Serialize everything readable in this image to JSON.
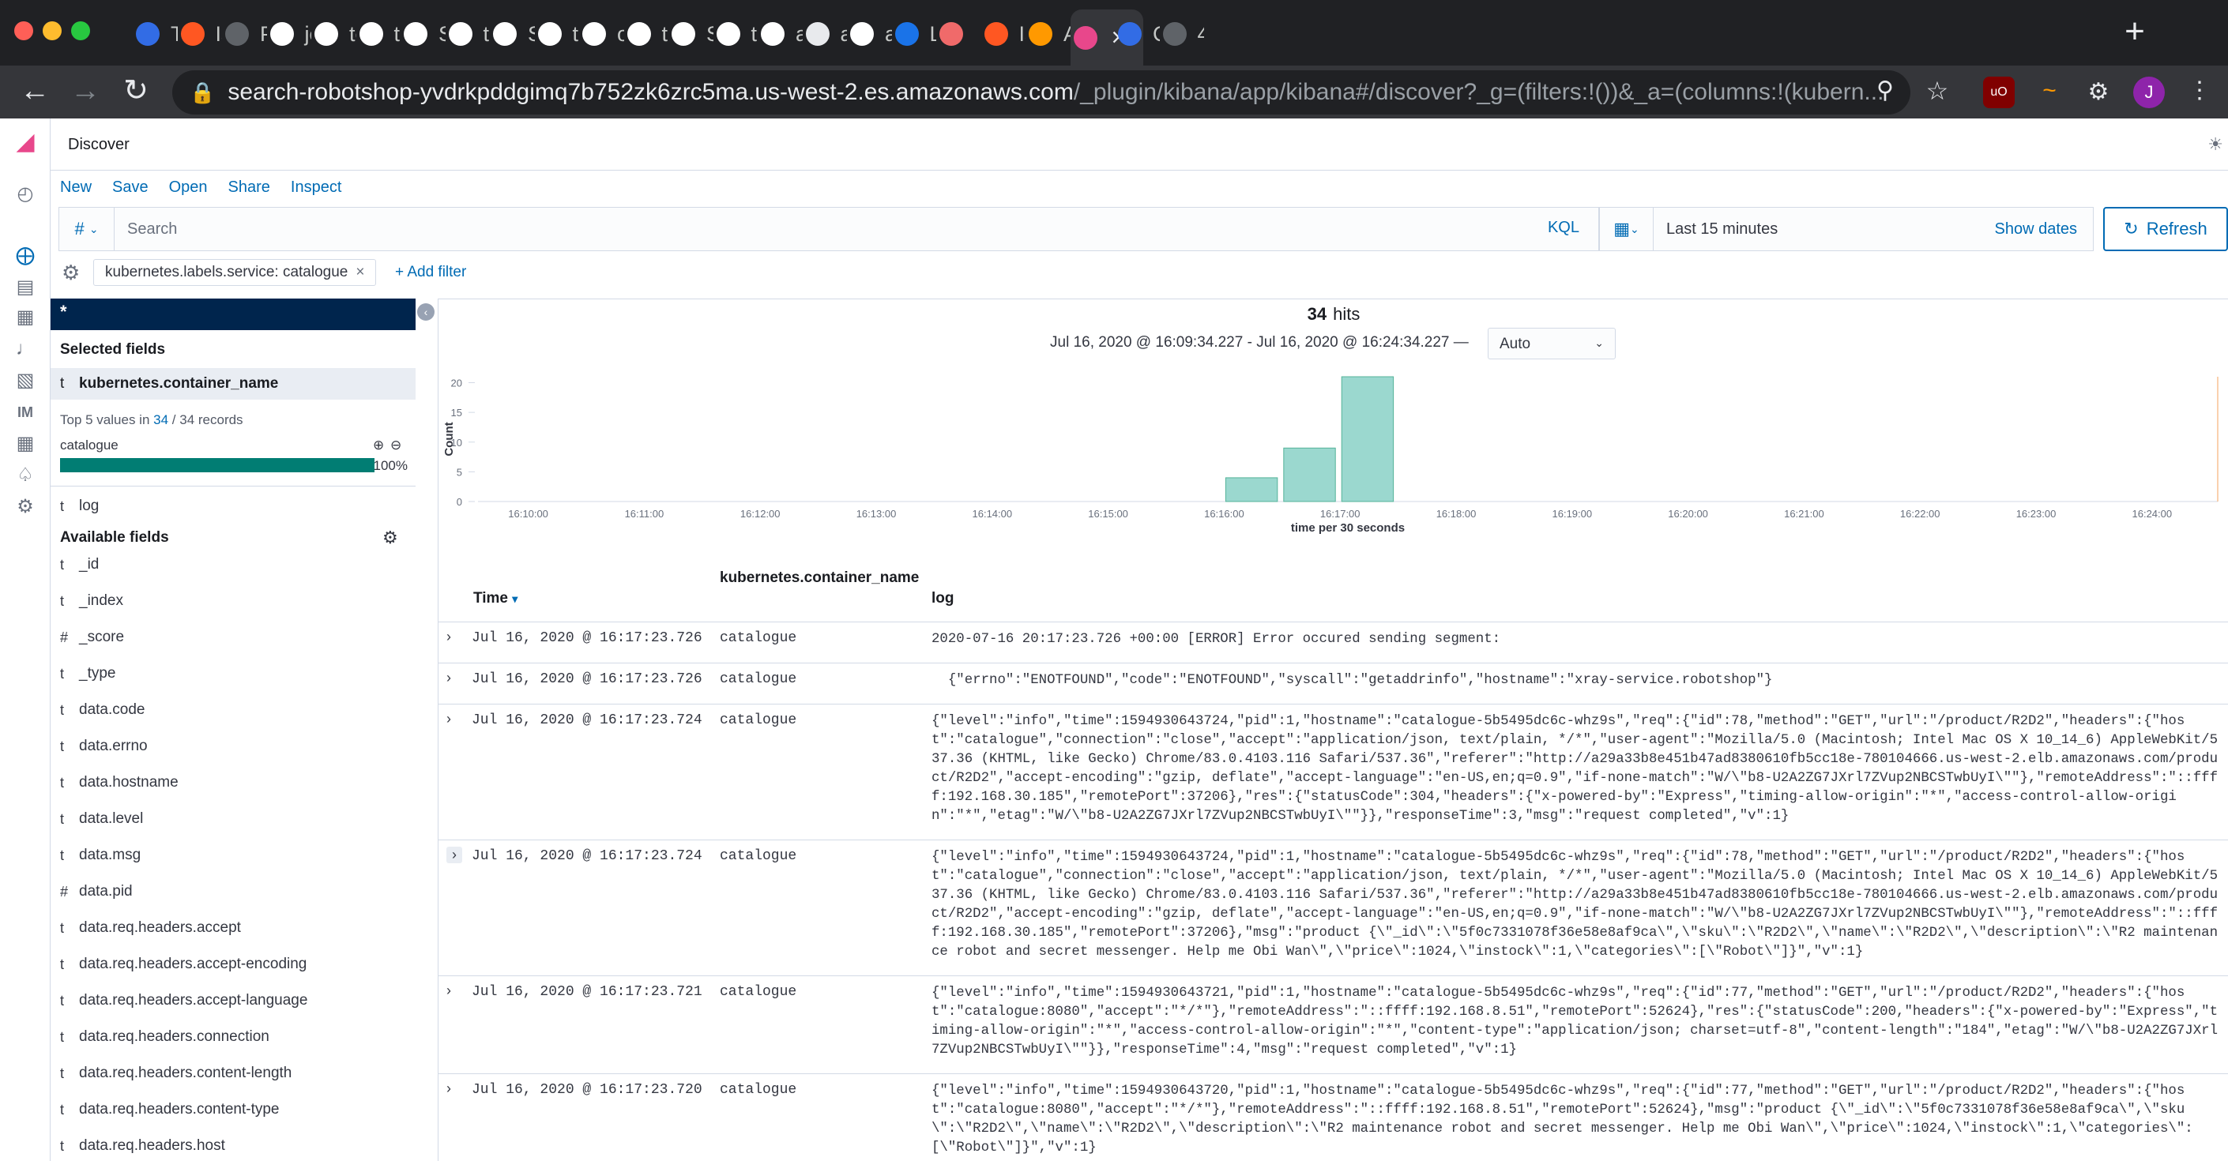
{
  "browser": {
    "tabs": [
      {
        "label": "Tr",
        "icon": "kubernetes-icon",
        "color": "#326ce5"
      },
      {
        "label": "Ist",
        "icon": "istio-icon",
        "color": "#ff5722"
      },
      {
        "label": "Pr",
        "icon": "globe-icon",
        "color": "#5f6368"
      },
      {
        "label": "jo",
        "icon": "github-icon",
        "color": "#ffffff"
      },
      {
        "label": "te",
        "icon": "github-icon",
        "color": "#ffffff"
      },
      {
        "label": "te",
        "icon": "github-icon",
        "color": "#ffffff"
      },
      {
        "label": "Se",
        "icon": "github-icon",
        "color": "#ffffff"
      },
      {
        "label": "te",
        "icon": "github-icon",
        "color": "#ffffff"
      },
      {
        "label": "Se",
        "icon": "github-icon",
        "color": "#ffffff"
      },
      {
        "label": "te",
        "icon": "github-icon",
        "color": "#ffffff"
      },
      {
        "label": "ou",
        "icon": "github-icon",
        "color": "#ffffff"
      },
      {
        "label": "te",
        "icon": "github-icon",
        "color": "#ffffff"
      },
      {
        "label": "Se",
        "icon": "github-icon",
        "color": "#ffffff"
      },
      {
        "label": "te",
        "icon": "github-icon",
        "color": "#ffffff"
      },
      {
        "label": "an",
        "icon": "github-icon",
        "color": "#ffffff"
      },
      {
        "label": "av",
        "icon": "globe-icon",
        "color": "#e8eaed"
      },
      {
        "label": "av",
        "icon": "github-icon",
        "color": "#ffffff"
      },
      {
        "label": "La",
        "icon": "aws-icon",
        "color": "#1a73e8"
      },
      {
        "label": "",
        "icon": "asana-icon",
        "color": "#f06a6a"
      },
      {
        "label": "Ist",
        "icon": "istio-icon",
        "color": "#ff5722"
      },
      {
        "label": "Ar",
        "icon": "aws-box-icon",
        "color": "#ff9900"
      },
      {
        "label": "",
        "icon": "kibana-icon",
        "color": "#e8478b"
      },
      {
        "label": "Co",
        "icon": "kubernetes-icon",
        "color": "#326ce5"
      },
      {
        "label": "40",
        "icon": "globe-icon",
        "color": "#5f6368"
      }
    ],
    "url_host": "search-robotshop-yvdrkpddgimq7b752zk6zrc5ma.us-west-2.es.amazonaws.com",
    "url_path": "/_plugin/kibana/app/kibana#/discover?_g=(filters:!())&_a=(columns:!(kubern...",
    "profile_initial": "J"
  },
  "kibana": {
    "app_title": "Discover",
    "top_nav": [
      "New",
      "Save",
      "Open",
      "Share",
      "Inspect"
    ],
    "query_lang_symbol": "#",
    "search_placeholder": "Search",
    "kql_label": "KQL",
    "time_range": "Last 15 minutes",
    "show_dates": "Show dates",
    "refresh": "Refresh",
    "filter_pill": "kubernetes.labels.service: catalogue",
    "add_filter": "+ Add filter",
    "accent": "#006bb4"
  },
  "sidebar": {
    "index_pattern": "*",
    "selected_heading": "Selected fields",
    "selected_fields": [
      {
        "type": "t",
        "name": "kubernetes.container_name"
      },
      {
        "type": "t",
        "name": "log"
      }
    ],
    "top_values_prefix": "Top 5 values in",
    "top_values_count": "34",
    "top_values_suffix": "/ 34 records",
    "top_value_name": "catalogue",
    "top_value_pct": "100%",
    "top_value_fraction": 1.0,
    "available_heading": "Available fields",
    "available_fields": [
      {
        "type": "t",
        "name": "_id"
      },
      {
        "type": "t",
        "name": "_index"
      },
      {
        "type": "#",
        "name": "_score"
      },
      {
        "type": "t",
        "name": "_type"
      },
      {
        "type": "t",
        "name": "data.code"
      },
      {
        "type": "t",
        "name": "data.errno"
      },
      {
        "type": "t",
        "name": "data.hostname"
      },
      {
        "type": "t",
        "name": "data.level"
      },
      {
        "type": "t",
        "name": "data.msg"
      },
      {
        "type": "#",
        "name": "data.pid"
      },
      {
        "type": "t",
        "name": "data.req.headers.accept"
      },
      {
        "type": "t",
        "name": "data.req.headers.accept-encoding"
      },
      {
        "type": "t",
        "name": "data.req.headers.accept-language"
      },
      {
        "type": "t",
        "name": "data.req.headers.connection"
      },
      {
        "type": "t",
        "name": "data.req.headers.content-length"
      },
      {
        "type": "t",
        "name": "data.req.headers.content-type"
      },
      {
        "type": "t",
        "name": "data.req.headers.host"
      }
    ]
  },
  "results": {
    "hits_count": "34",
    "hits_label": "hits",
    "range_text": "Jul 16, 2020 @ 16:09:34.227 - Jul 16, 2020 @ 16:24:34.227 —",
    "interval": "Auto",
    "columns": {
      "time": "Time",
      "container": "kubernetes.container_name",
      "log": "log"
    },
    "rows": [
      {
        "time": "Jul 16, 2020 @ 16:17:23.726",
        "container": "catalogue",
        "log": "2020-07-16 20:17:23.726 +00:00 [ERROR] Error occured sending segment:"
      },
      {
        "time": "Jul 16, 2020 @ 16:17:23.726",
        "container": "catalogue",
        "log": "  {\"errno\":\"ENOTFOUND\",\"code\":\"ENOTFOUND\",\"syscall\":\"getaddrinfo\",\"hostname\":\"xray-service.robotshop\"}"
      },
      {
        "time": "Jul 16, 2020 @ 16:17:23.724",
        "container": "catalogue",
        "log": "{\"level\":\"info\",\"time\":1594930643724,\"pid\":1,\"hostname\":\"catalogue-5b5495dc6c-whz9s\",\"req\":{\"id\":78,\"method\":\"GET\",\"url\":\"/product/R2D2\",\"headers\":{\"host\":\"catalogue\",\"connection\":\"close\",\"accept\":\"application/json, text/plain, */*\",\"user-agent\":\"Mozilla/5.0 (Macintosh; Intel Mac OS X 10_14_6) AppleWebKit/537.36 (KHTML, like Gecko) Chrome/83.0.4103.116 Safari/537.36\",\"referer\":\"http://a29a33b8e451b47ad8380610fb5cc18e-780104666.us-west-2.elb.amazonaws.com/product/R2D2\",\"accept-encoding\":\"gzip, deflate\",\"accept-language\":\"en-US,en;q=0.9\",\"if-none-match\":\"W/\\\"b8-U2A2ZG7JXrl7ZVup2NBCSTwbUyI\\\"\"},\"remoteAddress\":\"::ffff:192.168.30.185\",\"remotePort\":37206},\"res\":{\"statusCode\":304,\"headers\":{\"x-powered-by\":\"Express\",\"timing-allow-origin\":\"*\",\"access-control-allow-origin\":\"*\",\"etag\":\"W/\\\"b8-U2A2ZG7JXrl7ZVup2NBCSTwbUyI\\\"\"}},\"responseTime\":3,\"msg\":\"request completed\",\"v\":1}"
      },
      {
        "time": "Jul 16, 2020 @ 16:17:23.724",
        "container": "catalogue",
        "log": "{\"level\":\"info\",\"time\":1594930643724,\"pid\":1,\"hostname\":\"catalogue-5b5495dc6c-whz9s\",\"req\":{\"id\":78,\"method\":\"GET\",\"url\":\"/product/R2D2\",\"headers\":{\"host\":\"catalogue\",\"connection\":\"close\",\"accept\":\"application/json, text/plain, */*\",\"user-agent\":\"Mozilla/5.0 (Macintosh; Intel Mac OS X 10_14_6) AppleWebKit/537.36 (KHTML, like Gecko) Chrome/83.0.4103.116 Safari/537.36\",\"referer\":\"http://a29a33b8e451b47ad8380610fb5cc18e-780104666.us-west-2.elb.amazonaws.com/product/R2D2\",\"accept-encoding\":\"gzip, deflate\",\"accept-language\":\"en-US,en;q=0.9\",\"if-none-match\":\"W/\\\"b8-U2A2ZG7JXrl7ZVup2NBCSTwbUyI\\\"\"},\"remoteAddress\":\"::ffff:192.168.30.185\",\"remotePort\":37206},\"msg\":\"product {\\\"_id\\\":\\\"5f0c7331078f36e58e8af9ca\\\",\\\"sku\\\":\\\"R2D2\\\",\\\"name\\\":\\\"R2D2\\\",\\\"description\\\":\\\"R2 maintenance robot and secret messenger. Help me Obi Wan\\\",\\\"price\\\":1024,\\\"instock\\\":1,\\\"categories\\\":[\\\"Robot\\\"]}\",\"v\":1}"
      },
      {
        "time": "Jul 16, 2020 @ 16:17:23.721",
        "container": "catalogue",
        "log": "{\"level\":\"info\",\"time\":1594930643721,\"pid\":1,\"hostname\":\"catalogue-5b5495dc6c-whz9s\",\"req\":{\"id\":77,\"method\":\"GET\",\"url\":\"/product/R2D2\",\"headers\":{\"host\":\"catalogue:8080\",\"accept\":\"*/*\"},\"remoteAddress\":\"::ffff:192.168.8.51\",\"remotePort\":52624},\"res\":{\"statusCode\":200,\"headers\":{\"x-powered-by\":\"Express\",\"timing-allow-origin\":\"*\",\"access-control-allow-origin\":\"*\",\"content-type\":\"application/json; charset=utf-8\",\"content-length\":\"184\",\"etag\":\"W/\\\"b8-U2A2ZG7JXrl7ZVup2NBCSTwbUyI\\\"\"}},\"responseTime\":4,\"msg\":\"request completed\",\"v\":1}"
      },
      {
        "time": "Jul 16, 2020 @ 16:17:23.720",
        "container": "catalogue",
        "log": "{\"level\":\"info\",\"time\":1594930643720,\"pid\":1,\"hostname\":\"catalogue-5b5495dc6c-whz9s\",\"req\":{\"id\":77,\"method\":\"GET\",\"url\":\"/product/R2D2\",\"headers\":{\"host\":\"catalogue:8080\",\"accept\":\"*/*\"},\"remoteAddress\":\"::ffff:192.168.8.51\",\"remotePort\":52624},\"msg\":\"product {\\\"_id\\\":\\\"5f0c7331078f36e58e8af9ca\\\",\\\"sku\\\":\\\"R2D2\\\",\\\"name\\\":\\\"R2D2\\\",\\\"description\\\":\\\"R2 maintenance robot and secret messenger. Help me Obi Wan\\\",\\\"price\\\":1024,\\\"instock\\\":1,\\\"categories\\\":[\\\"Robot\\\"]}\",\"v\":1}"
      }
    ]
  },
  "chart_data": {
    "type": "bar",
    "xlabel": "time per 30 seconds",
    "ylabel": "Count",
    "ylim": [
      0,
      21
    ],
    "yticks": [
      0,
      5,
      10,
      15,
      20
    ],
    "xticks": [
      "16:10:00",
      "16:11:00",
      "16:12:00",
      "16:13:00",
      "16:14:00",
      "16:15:00",
      "16:16:00",
      "16:17:00",
      "16:18:00",
      "16:19:00",
      "16:20:00",
      "16:21:00",
      "16:22:00",
      "16:23:00",
      "16:24:00"
    ],
    "x_range": [
      "16:09:34",
      "16:24:34"
    ],
    "bars": [
      {
        "start": "16:16:00",
        "value": 4
      },
      {
        "start": "16:16:30",
        "value": 9
      },
      {
        "start": "16:17:00",
        "value": 21
      }
    ],
    "bar_color": "#9bd8cf",
    "bar_edge": "#54b399"
  }
}
